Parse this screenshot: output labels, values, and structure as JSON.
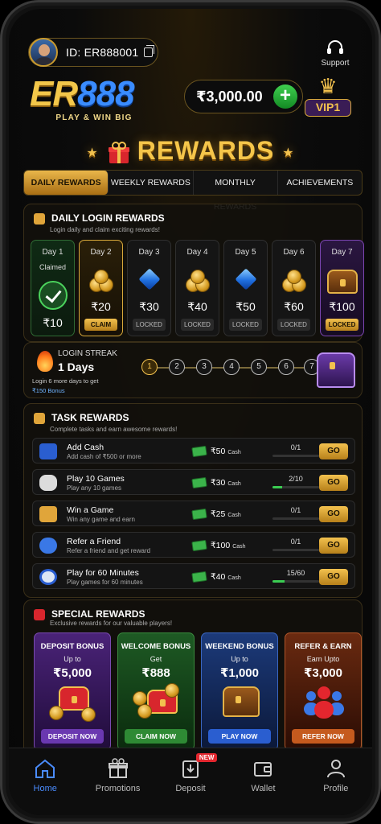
{
  "header": {
    "user_id": "ID: ER888001",
    "support_label": "Support",
    "logo_text_a": "ER",
    "logo_text_b": "888",
    "logo_tagline": "PLAY & WIN BIG",
    "balance": "₹3,000.00",
    "add_symbol": "+",
    "vip_label": "VIP1"
  },
  "title": "REWARDS",
  "tabs": [
    {
      "label": "DAILY REWARDS",
      "active": true
    },
    {
      "label": "WEEKLY REWARDS",
      "active": false
    },
    {
      "label": "MONTHLY REWARDS",
      "active": false
    },
    {
      "label": "ACHIEVEMENTS",
      "active": false
    }
  ],
  "daily": {
    "heading": "DAILY LOGIN REWARDS",
    "subtitle": "Login daily and claim exciting rewards!",
    "days": [
      {
        "name": "Day 1",
        "status": "Claimed",
        "value": "₹10",
        "state": "claimed"
      },
      {
        "name": "Day 2",
        "value": "₹20",
        "button": "CLAIM",
        "state": "current",
        "icon": "coins-icon"
      },
      {
        "name": "Day 3",
        "value": "₹30",
        "button": "LOCKED",
        "state": "locked",
        "icon": "diamond-icon"
      },
      {
        "name": "Day 4",
        "value": "₹40",
        "button": "LOCKED",
        "state": "locked",
        "icon": "coins-icon"
      },
      {
        "name": "Day 5",
        "value": "₹50",
        "button": "LOCKED",
        "state": "locked",
        "icon": "diamond-icon"
      },
      {
        "name": "Day 6",
        "value": "₹60",
        "button": "LOCKED",
        "state": "locked",
        "icon": "coins-icon"
      },
      {
        "name": "Day 7",
        "value": "₹100",
        "button": "LOCKED",
        "state": "locked",
        "icon": "chest-icon"
      }
    ]
  },
  "streak": {
    "label": "LOGIN STREAK",
    "value": "1 Days",
    "hint": "Login 6 more days to get",
    "bonus": "₹150 Bonus",
    "steps": [
      "1",
      "2",
      "3",
      "4",
      "5",
      "6",
      "7"
    ]
  },
  "tasks": {
    "heading": "TASK REWARDS",
    "subtitle": "Complete tasks and earn awesome rewards!",
    "cash_label": "Cash",
    "go_label": "GO",
    "items": [
      {
        "title": "Add Cash",
        "desc": "Add cash of ₹500 or more",
        "reward": "₹50",
        "progress": "0/1",
        "fraction": 0,
        "icon": "wallet-icon"
      },
      {
        "title": "Play 10 Games",
        "desc": "Play any 10 games",
        "reward": "₹30",
        "progress": "2/10",
        "fraction": 0.2,
        "icon": "gamepad-icon"
      },
      {
        "title": "Win a Game",
        "desc": "Win any game and earn",
        "reward": "₹25",
        "progress": "0/1",
        "fraction": 0,
        "icon": "trophy-icon"
      },
      {
        "title": "Refer a Friend",
        "desc": "Refer a friend and get reward",
        "reward": "₹100",
        "progress": "0/1",
        "fraction": 0,
        "icon": "users-icon"
      },
      {
        "title": "Play for 60 Minutes",
        "desc": "Play games for 60 minutes",
        "reward": "₹40",
        "progress": "15/60",
        "fraction": 0.25,
        "icon": "clock-icon"
      }
    ]
  },
  "special": {
    "heading": "SPECIAL REWARDS",
    "subtitle": "Exclusive rewards for our valuable players!",
    "cards": [
      {
        "title": "DEPOSIT BONUS",
        "sub": "Up to",
        "value": "₹5,000",
        "button": "DEPOSIT NOW"
      },
      {
        "title": "WELCOME BONUS",
        "sub": "Get",
        "value": "₹888",
        "button": "CLAIM NOW"
      },
      {
        "title": "WEEKEND BONUS",
        "sub": "Up to",
        "value": "₹1,000",
        "button": "PLAY NOW"
      },
      {
        "title": "REFER & EARN",
        "sub": "Earn Upto",
        "value": "₹3,000",
        "button": "REFER NOW"
      }
    ]
  },
  "nav": {
    "items": [
      {
        "label": "Home",
        "active": true
      },
      {
        "label": "Promotions",
        "active": false
      },
      {
        "label": "Deposit",
        "active": false
      },
      {
        "label": "Wallet",
        "active": false
      },
      {
        "label": "Profile",
        "active": false
      }
    ],
    "new_badge": "NEW"
  },
  "colors": {
    "accent": "#f2c14e",
    "active_nav": "#4a8cff",
    "progress": "#3bcc52"
  }
}
